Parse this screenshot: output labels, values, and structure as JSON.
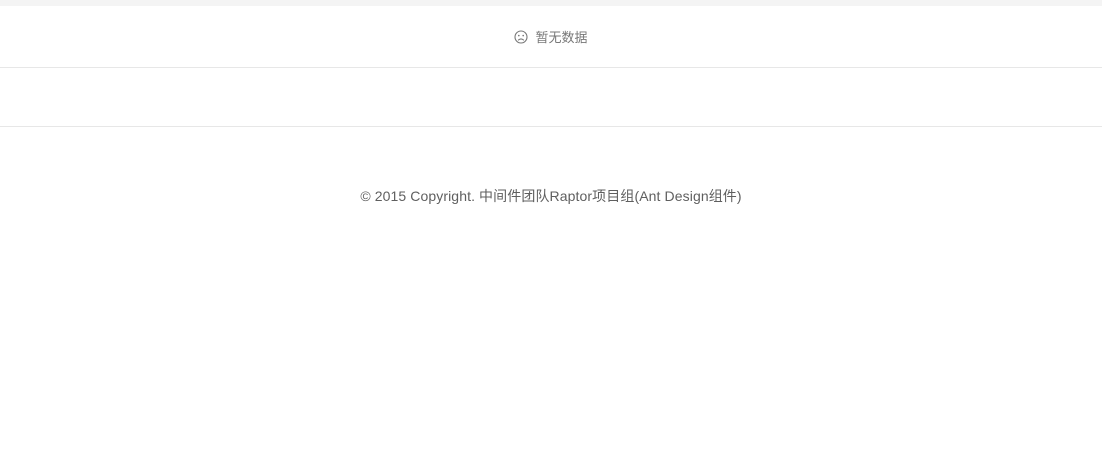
{
  "table": {
    "empty_text": "暂无数据",
    "empty_icon": "frown-icon"
  },
  "footer": {
    "copyright": "© 2015 Copyright. 中间件团队Raptor项目组(Ant Design组件)"
  }
}
